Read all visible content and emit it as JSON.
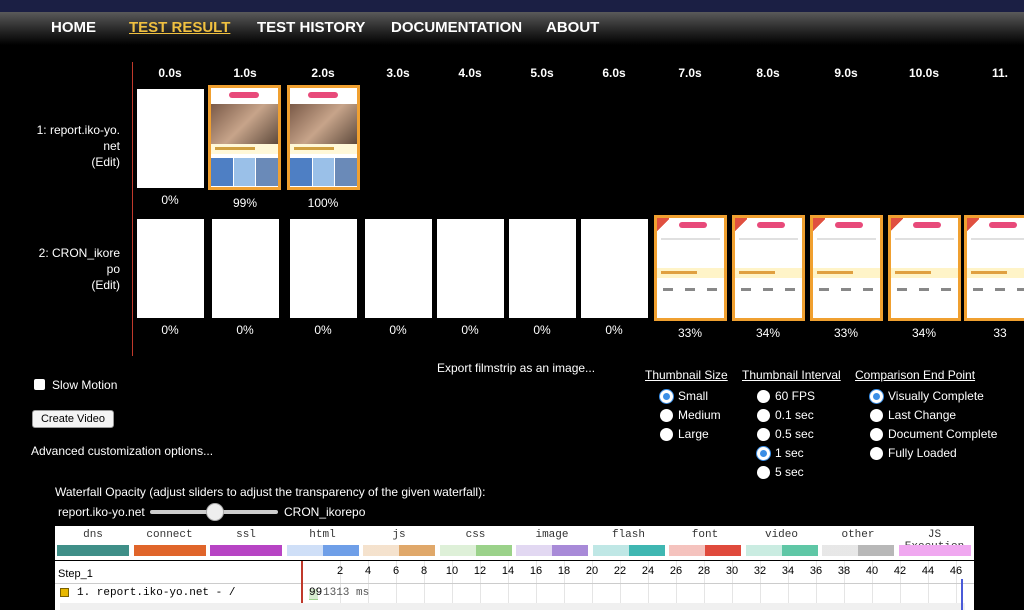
{
  "nav": {
    "items": [
      {
        "label": "HOME"
      },
      {
        "label": "TEST RESULT"
      },
      {
        "label": "TEST HISTORY"
      },
      {
        "label": "DOCUMENTATION"
      },
      {
        "label": "ABOUT"
      }
    ],
    "active": "TEST RESULT"
  },
  "filmstrip": {
    "times": [
      "0.0s",
      "1.0s",
      "2.0s",
      "3.0s",
      "4.0s",
      "5.0s",
      "6.0s",
      "7.0s",
      "8.0s",
      "9.0s",
      "10.0s",
      "11."
    ],
    "rows": [
      {
        "label_1": "1: report.iko-yo.",
        "label_2": "net",
        "edit": "(Edit)",
        "percents": [
          "0%",
          "99%",
          "100%"
        ]
      },
      {
        "label_1": "2: CRON_ikore",
        "label_2": "po",
        "edit": "(Edit)",
        "percents": [
          "0%",
          "0%",
          "0%",
          "0%",
          "0%",
          "0%",
          "0%",
          "33%",
          "34%",
          "33%",
          "34%",
          "33"
        ]
      }
    ],
    "export_link": "Export filmstrip as an image..."
  },
  "controls": {
    "slow_motion": "Slow Motion",
    "create_video": "Create Video",
    "advanced": "Advanced customization options...",
    "thumb_size": {
      "title": "Thumbnail Size",
      "options": [
        "Small",
        "Medium",
        "Large"
      ],
      "selected": "Small"
    },
    "thumb_interval": {
      "title": "Thumbnail Interval",
      "options": [
        "60 FPS",
        "0.1 sec",
        "0.5 sec",
        "1 sec",
        "5 sec"
      ],
      "selected": "1 sec"
    },
    "end_point": {
      "title": "Comparison End Point",
      "options": [
        "Visually Complete",
        "Last Change",
        "Document Complete",
        "Fully Loaded"
      ],
      "selected": "Visually Complete"
    }
  },
  "waterfall": {
    "opacity_label": "Waterfall Opacity (adjust sliders to adjust the transparency of the given waterfall):",
    "left_label": "report.iko-yo.net",
    "right_label": "CRON_ikorepo",
    "opacity": 0.5,
    "legend": [
      {
        "name": "dns",
        "color": "#3f8f88"
      },
      {
        "name": "connect",
        "color": "#e0652a"
      },
      {
        "name": "ssl",
        "color": "#b744c4"
      },
      {
        "name": "html",
        "color": "#6f9fe8"
      },
      {
        "name": "js",
        "color": "#e0a86a"
      },
      {
        "name": "css",
        "color": "#9bd28a"
      },
      {
        "name": "image",
        "color": "#a88ad8"
      },
      {
        "name": "flash",
        "color": "#3fb7b2"
      },
      {
        "name": "font",
        "color": "#e04a3c"
      },
      {
        "name": "video",
        "color": "#5fc7a6"
      },
      {
        "name": "other",
        "color": "#b8b8b8"
      },
      {
        "name": "JS Execution",
        "color": "#f0a8f0"
      }
    ],
    "step": "Step_1",
    "ticks": [
      "2",
      "4",
      "6",
      "8",
      "10",
      "12",
      "14",
      "16",
      "18",
      "20",
      "22",
      "24",
      "26",
      "28",
      "30",
      "32",
      "34",
      "36",
      "38",
      "40",
      "42",
      "44",
      "46"
    ],
    "request_1": "1. report.iko-yo.net - /",
    "request_1_time": "1313 ms",
    "request_1_ttfb": "99"
  }
}
